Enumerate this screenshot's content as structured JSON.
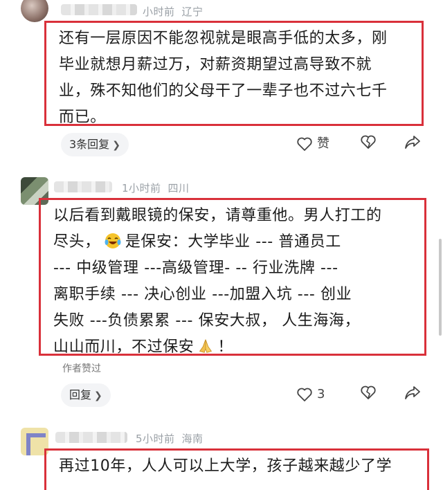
{
  "comments": [
    {
      "time": "小时前",
      "location": "辽宁",
      "text": "还有一层原因不能忽视就是眼高手低的太多，刚毕业就想月薪过万，对薪资期望过高导致不就业，殊不知他们的父母干了一辈子也不过六七千而已。",
      "lines": [
        "还有一层原因不能忽视就是眼高手低的太多，刚",
        "毕业就想月薪过万，对薪资期望过高导致不就",
        "业，殊不知他们的父母干了一辈子也不过六七千",
        "而已。"
      ],
      "reply_label": "3条回复",
      "like_label": "赞"
    },
    {
      "time": "1小时前",
      "location": "四川",
      "lines_a": [
        "以后看到戴眼镜的保安，请尊重他。男人打工的"
      ],
      "line2_before": "尽头，",
      "line2_after": "是保安：大学毕业 --- 普通员工",
      "lines_b": [
        "--- 中级管理 ---高级管理- -- 行业洗牌 ---",
        "离职手续 --- 决心创业 ---加盟入坑 --- 创业",
        "失败 ---负债累累 --- 保安大叔， 人生海海，"
      ],
      "line7_before": "山山而川，不过保安",
      "line7_after": "！",
      "author_liked": "作者赞过",
      "reply_label": "回复",
      "like_count": "3"
    },
    {
      "time": "5小时前",
      "location": "海南",
      "lines": [
        "再过10年，人人可以上大学，孩子越来越少了学"
      ]
    }
  ],
  "icons": {
    "chevron": "chevron-right-icon",
    "like": "heart-like-icon",
    "dislike": "heart-dislike-icon",
    "share": "share-arrow-icon",
    "laughing_emoji": "laughing-crying-emoji",
    "pray_emoji": "praying-hands-emoji"
  },
  "colors": {
    "highlight_border": "#d9303a",
    "meta_text": "#9aa0a6",
    "pill_bg": "#f3f4f6"
  }
}
